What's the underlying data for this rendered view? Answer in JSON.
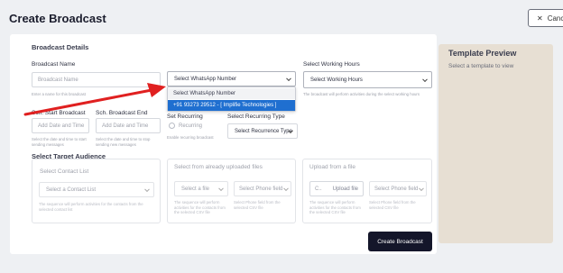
{
  "header": {
    "title": "Create Broadcast",
    "cancel_label": "Cance"
  },
  "section": {
    "details": "Broadcast Details",
    "target": "Select Target Audience"
  },
  "broadcast_name": {
    "label": "Broadcast Name",
    "placeholder": "Broadcast Name",
    "help": "Enter a name for this broadcast"
  },
  "whatsapp": {
    "value": "Select WhatsApp Number",
    "options": [
      "Select WhatsApp Number",
      "+91 93273 29512 - [ Implifie Technologies ]"
    ]
  },
  "working_hours": {
    "label": "Select Working Hours",
    "value": "Select Working Hours",
    "help": "The broadcast will perform activities during the select working hours"
  },
  "start": {
    "label": "Sch. Start Broadcast",
    "placeholder": "Add Date and Time",
    "help": "Select the date and time to start sending messages"
  },
  "end": {
    "label": "Sch. Broadcast End",
    "placeholder": "Add Date and Time",
    "help": "Select the date and time to stop sending new messages"
  },
  "recurring": {
    "label": "Set Recurring",
    "radio_label": "Recurring",
    "help": "Enable recurring broadcast"
  },
  "recurring_type": {
    "label": "Select Recurring Type",
    "value": "Select Recurrence Type"
  },
  "contact_list": {
    "title": "Select Contact List",
    "value": "Select a Contact List",
    "help": "The sequence will perform activities for the contacts from the selected contact list"
  },
  "uploaded": {
    "title": "Select from already uploaded files",
    "file": "Select a file",
    "phone": "Select Phone field",
    "help1": "The sequence will perform activities for the contacts from the selected CSV file",
    "help2": "Select Phone field from the selected CSV file"
  },
  "upload": {
    "title": "Upload from a file",
    "c": "C..",
    "upload_label": "Upload file",
    "phone": "Select Phone field",
    "help1": "The sequence will perform activities for the contacts from the selected CSV file",
    "help2": "Select Phone field from the selected CSV file"
  },
  "template": {
    "title": "Template Preview",
    "subtitle": "Select a template to view"
  },
  "actions": {
    "create": "Create Broadcast"
  },
  "colors": {
    "primary": "#14162a",
    "selected": "#1f6fd0",
    "arrow": "#e02020",
    "template_bg": "#e7dfd3"
  }
}
